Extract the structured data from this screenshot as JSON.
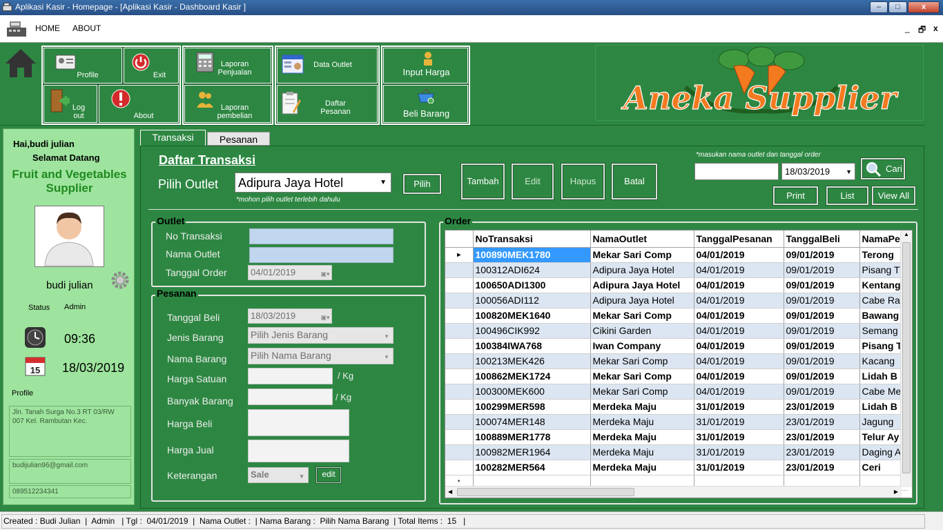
{
  "window": {
    "title": "Aplikasi Kasir - Homepage - [Aplikasi Kasir - Dashboard Kasir ]",
    "min": "–",
    "max": "□",
    "close": "x"
  },
  "menu": {
    "home": "HOME",
    "about": "ABOUT",
    "mdi_min": "_",
    "mdi_restore": "🗗",
    "mdi_close": "x"
  },
  "toolbar": {
    "profile": "Profile",
    "exit": "Exit",
    "logout": "Log out",
    "about": "About",
    "laporan_penjualan": "Laporan Penjualan",
    "laporan_pembelian": "Laporan pembelian",
    "data_outlet": "Data Outlet",
    "daftar_pesanan": "Daftar Pesanan",
    "input_harga": "Input Harga",
    "beli_barang": "Beli Barang"
  },
  "logo": {
    "text": "Aneka Supplier"
  },
  "sidebar": {
    "greeting": "Hai,budi julian",
    "welcome": "Selamat Datang",
    "tagline": "Fruit and Vegetables Supplier",
    "username": "budi julian",
    "status_label": "Status",
    "status_value": "Admin",
    "time": "09:36",
    "date": "18/03/2019",
    "profile_label": "Profile",
    "address": "Jln. Tanah Surga No.3 RT 03/RW 007 Kel. Rambutan Kec.",
    "email": "budijulian96@gmail.com",
    "phone": "089512234341",
    "calendar_day": "15"
  },
  "tabs": {
    "transaksi": "Transaksi",
    "pesanan": "Pesanan"
  },
  "main": {
    "title": "Daftar Transaksi",
    "pilih_outlet_label": "Pilih Outlet",
    "outlet_selected": "Adipura Jaya Hotel",
    "pilih_button": "Pilih",
    "outlet_hint": "*mohon pilih outlet terlebih dahulu",
    "tambah": "Tambah",
    "edit": "Edit",
    "hapus": "Hapus",
    "batal": "Batal",
    "search_hint": "*masukan nama outlet dan tanggal order",
    "search_date": "18/03/2019",
    "cari": "Cari",
    "print": "Print",
    "list": "List",
    "view_all": "View All"
  },
  "outlet_frame": {
    "title": "Outlet",
    "no_transaksi": "No Transaksi",
    "nama_outlet": "Nama Outlet",
    "tanggal_order": "Tanggal Order",
    "tanggal_order_value": "04/01/2019"
  },
  "pesanan_frame": {
    "title": "Pesanan",
    "tanggal_beli": "Tanggal Beli",
    "tanggal_beli_value": "18/03/2019",
    "jenis_barang": "Jenis Barang",
    "jenis_barang_value": "Pilih Jenis Barang",
    "nama_barang": "Nama Barang",
    "nama_barang_value": "Pilih Nama Barang",
    "harga_satuan": "Harga Satuan",
    "per_kg_1": "/ Kg",
    "banyak_barang": "Banyak Barang",
    "per_kg_2": "/ Kg",
    "harga_beli": "Harga Beli",
    "harga_jual": "Harga Jual",
    "keterangan": "Keterangan",
    "keterangan_value": "Sale",
    "edit_button": "edit"
  },
  "order": {
    "title": "Order",
    "columns": [
      "NoTransaksi",
      "NamaOutlet",
      "TanggalPesanan",
      "TanggalBeli",
      "NamaPe"
    ],
    "rows": [
      [
        "100890MEK1780",
        "Mekar Sari Comp",
        "04/01/2019",
        "09/01/2019",
        "Terong"
      ],
      [
        "100312ADI624",
        "Adipura Jaya Hotel",
        "04/01/2019",
        "09/01/2019",
        "Pisang T"
      ],
      [
        "100650ADI1300",
        "Adipura Jaya Hotel",
        "04/01/2019",
        "09/01/2019",
        "Kentang"
      ],
      [
        "100056ADI112",
        "Adipura Jaya Hotel",
        "04/01/2019",
        "09/01/2019",
        "Cabe Ra"
      ],
      [
        "100820MEK1640",
        "Mekar Sari Comp",
        "04/01/2019",
        "09/01/2019",
        "Bawang"
      ],
      [
        "100496CIK992",
        "Cikini Garden",
        "04/01/2019",
        "09/01/2019",
        "Semang"
      ],
      [
        "100384IWA768",
        "Iwan Company",
        "04/01/2019",
        "09/01/2019",
        "Pisang T"
      ],
      [
        "100213MEK426",
        "Mekar Sari Comp",
        "04/01/2019",
        "09/01/2019",
        "Kacang"
      ],
      [
        "100862MEK1724",
        "Mekar Sari Comp",
        "04/01/2019",
        "09/01/2019",
        "Lidah B"
      ],
      [
        "100300MEK600",
        "Mekar Sari Comp",
        "04/01/2019",
        "09/01/2019",
        "Cabe Me"
      ],
      [
        "100299MER598",
        "Merdeka Maju",
        "31/01/2019",
        "23/01/2019",
        "Lidah B"
      ],
      [
        "100074MER148",
        "Merdeka Maju",
        "31/01/2019",
        "23/01/2019",
        "Jagung"
      ],
      [
        "100889MER1778",
        "Merdeka Maju",
        "31/01/2019",
        "23/01/2019",
        "Telur Ay"
      ],
      [
        "100982MER1964",
        "Merdeka Maju",
        "31/01/2019",
        "23/01/2019",
        "Daging A"
      ],
      [
        "100282MER564",
        "Merdeka Maju",
        "31/01/2019",
        "23/01/2019",
        "Ceri"
      ]
    ],
    "current_marker": "▸",
    "new_row_marker": "*"
  },
  "status_bar": "Created : Budi Julian  |  Admin   | Tgl :  04/01/2019  |  Nama Outlet :  | Nama Barang :  Pilih Nama Barang  | Total Items :  15   |"
}
